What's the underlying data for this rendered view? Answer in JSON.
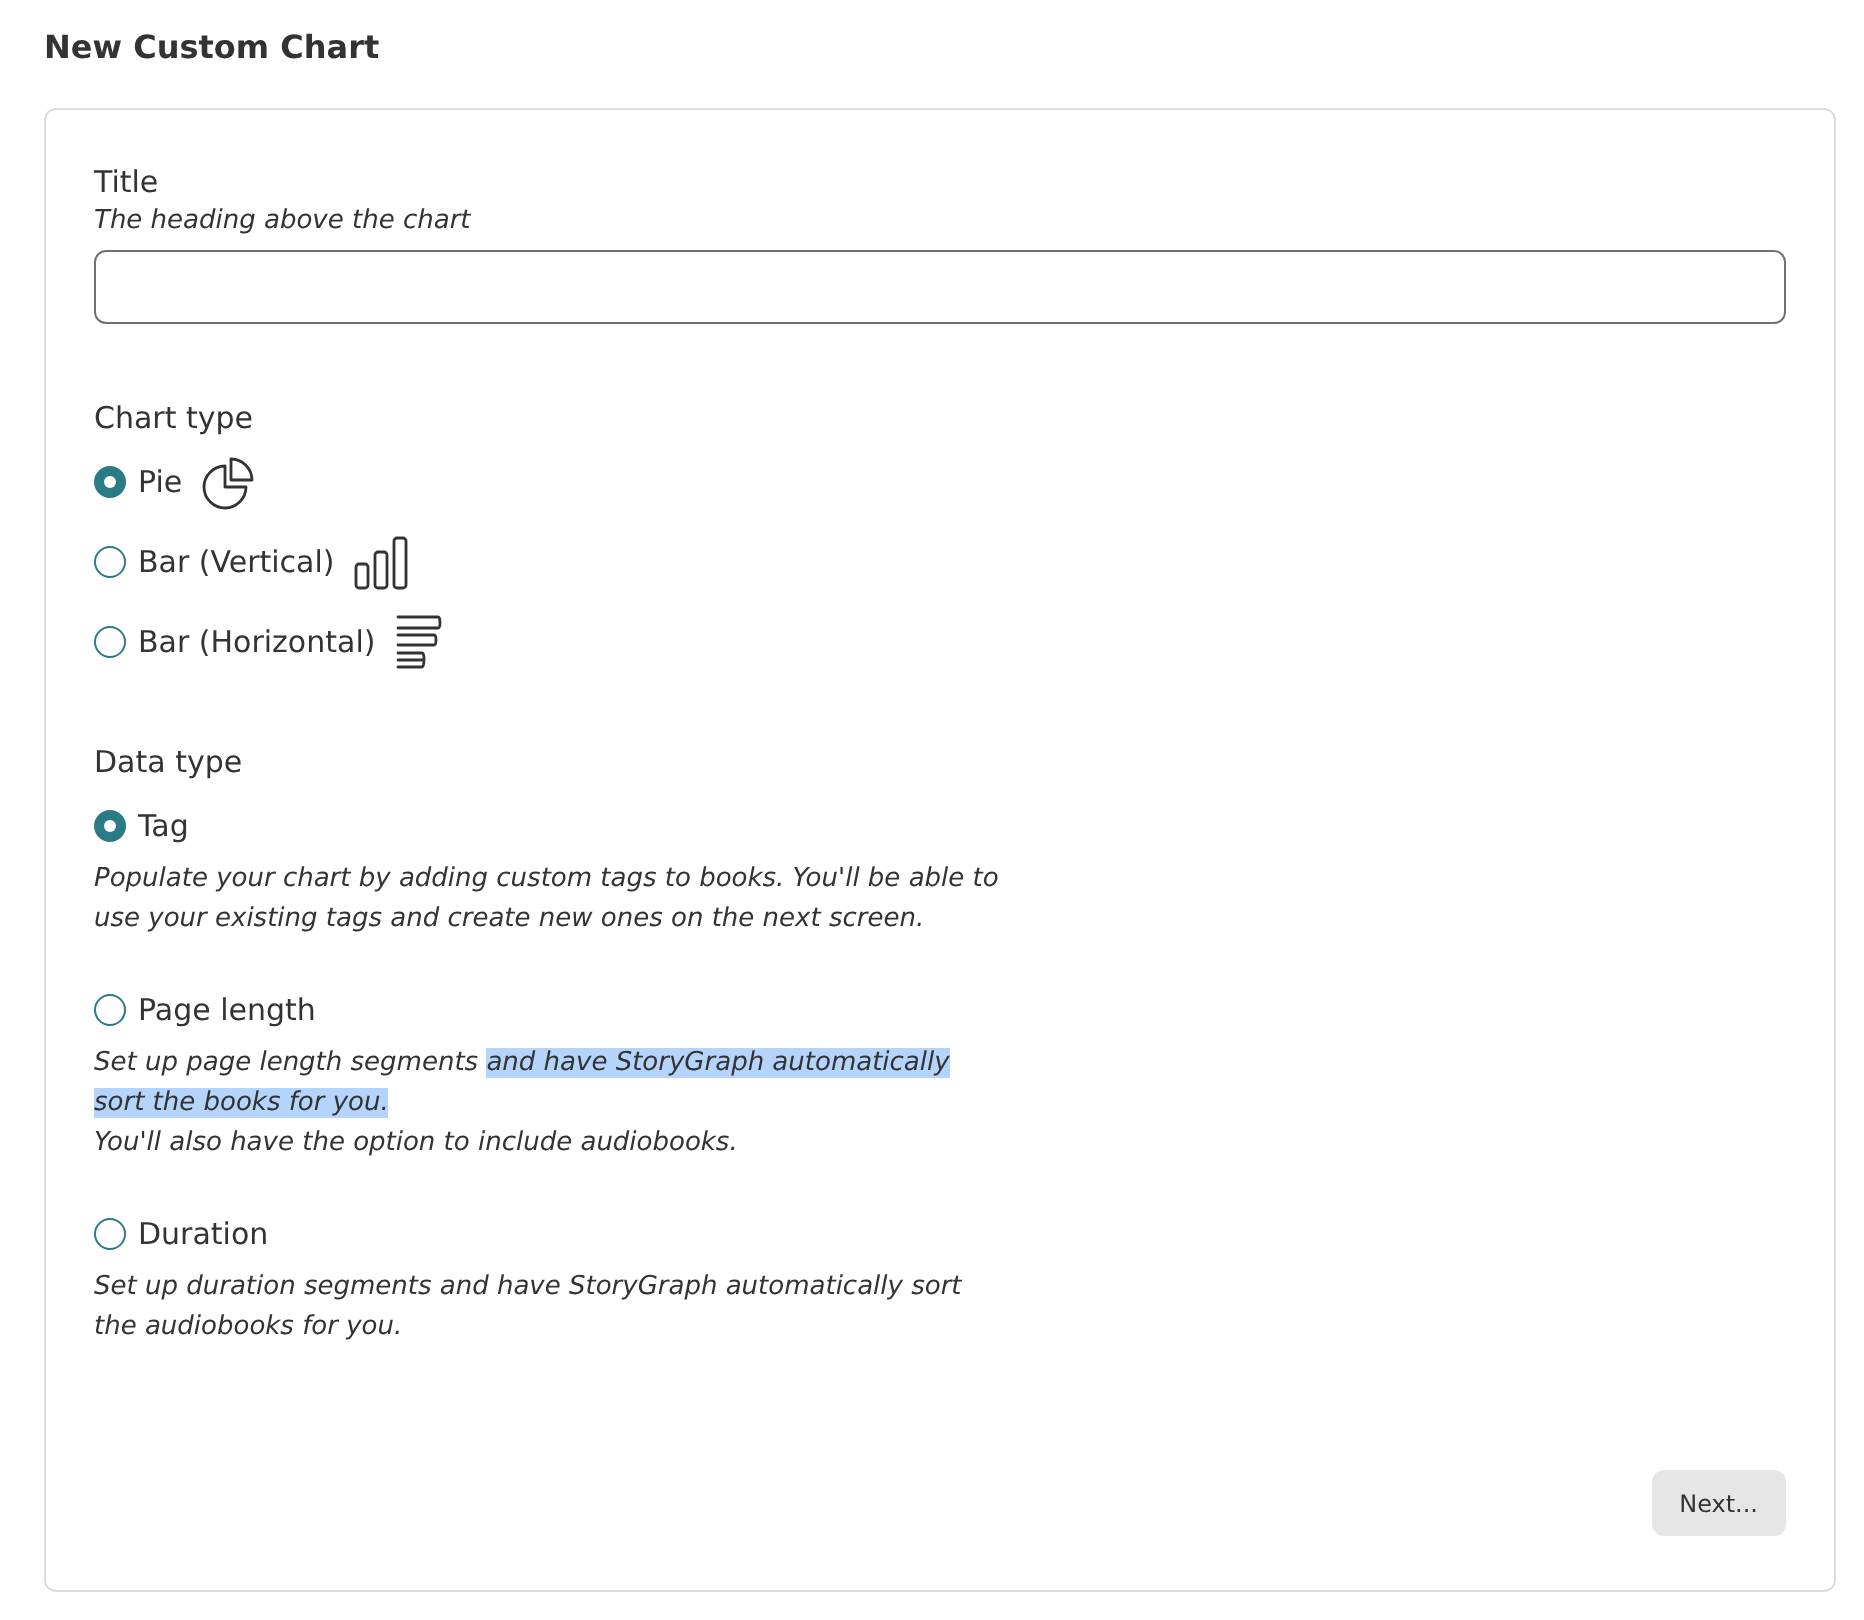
{
  "page": {
    "title": "New Custom Chart"
  },
  "title_field": {
    "label": "Title",
    "hint": "The heading above the chart"
  },
  "chart_type": {
    "label": "Chart type",
    "options": [
      {
        "label": "Pie",
        "kind": "pie",
        "selected": true
      },
      {
        "label": "Bar (Vertical)",
        "kind": "bar_vertical",
        "selected": false
      },
      {
        "label": "Bar (Horizontal)",
        "kind": "bar_horizontal",
        "selected": false
      }
    ]
  },
  "data_type": {
    "label": "Data type",
    "options": [
      {
        "label": "Tag",
        "selected": true,
        "description": [
          {
            "text": "Populate your chart by adding custom tags to books. You'll be able to use your existing tags and create new ones on the next screen.",
            "selected": false
          }
        ]
      },
      {
        "label": "Page length",
        "selected": false,
        "description": [
          {
            "text": "Set up page length segments",
            "selected": false
          },
          {
            "text": "and have StoryGraph automatically sort the books for you.",
            "selected": true
          }
        ],
        "note": "You'll also have the option to include audiobooks."
      },
      {
        "label": "Duration",
        "selected": false,
        "description": [
          {
            "text": "Set up duration segments and have StoryGraph automatically sort the audiobooks for you.",
            "selected": false
          }
        ]
      }
    ]
  },
  "next_button": {
    "label": "Next..."
  }
}
